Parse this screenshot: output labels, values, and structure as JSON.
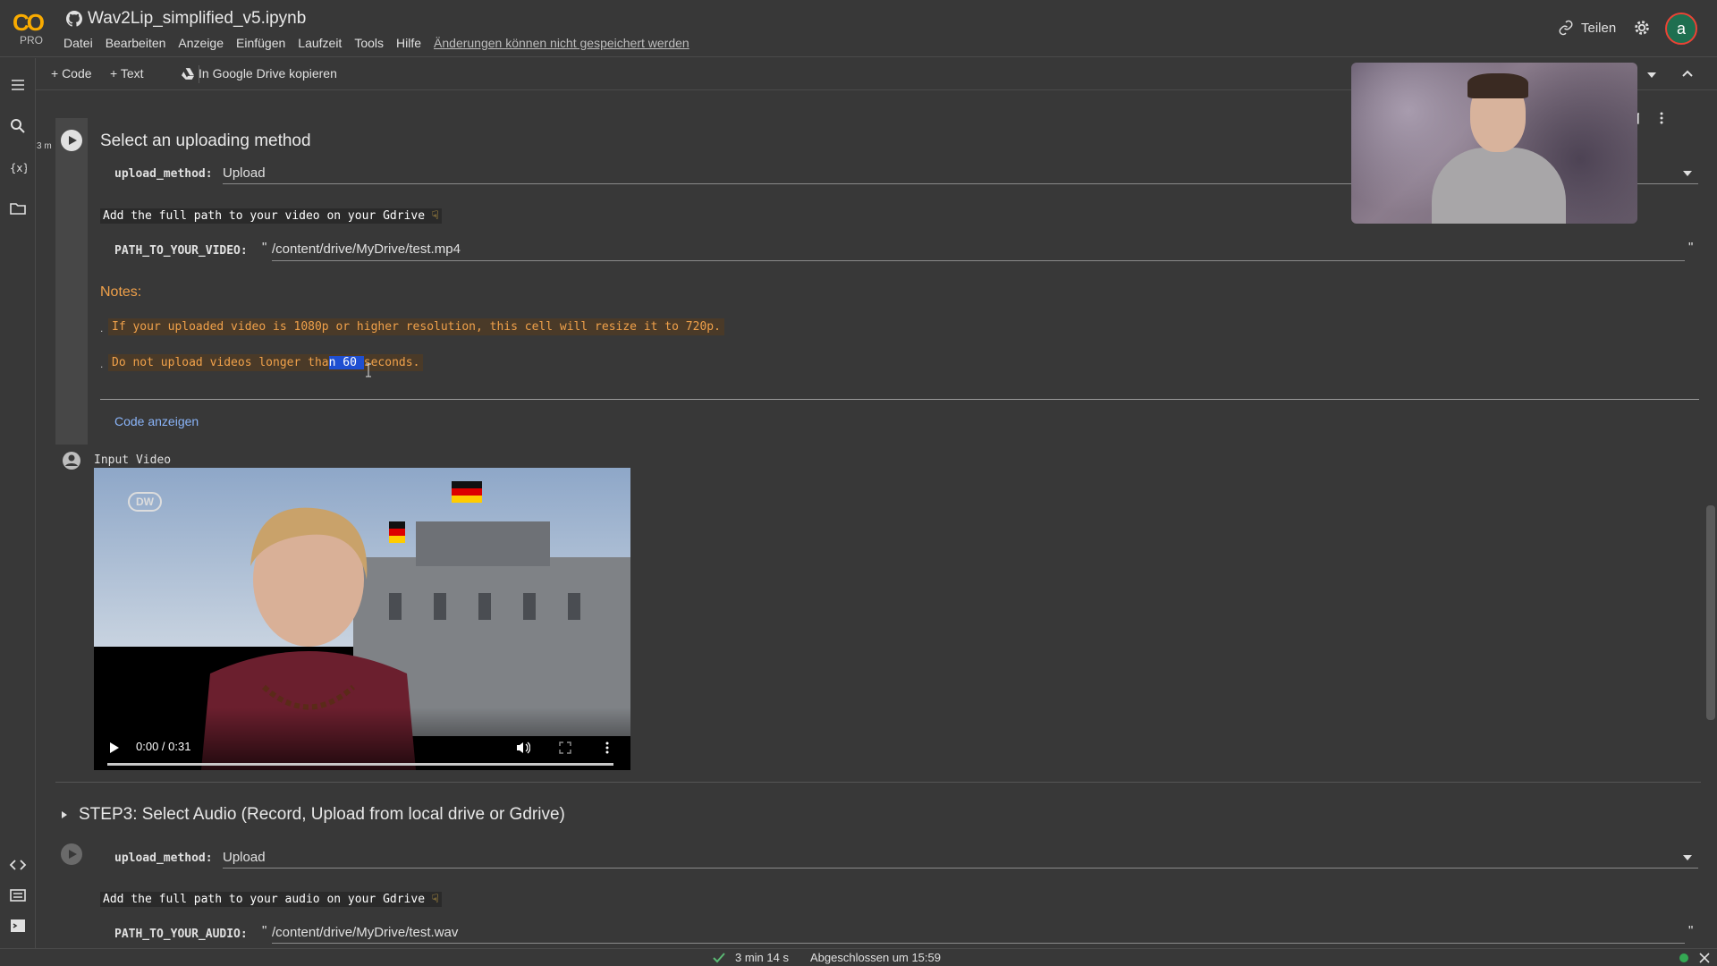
{
  "header": {
    "logo_text": "CO",
    "logo_sub": "PRO",
    "notebook_title": "Wav2Lip_simplified_v5.ipynb",
    "menu": [
      "Datei",
      "Bearbeiten",
      "Anzeige",
      "Einfügen",
      "Laufzeit",
      "Tools",
      "Hilfe"
    ],
    "save_warning": "Änderungen können nicht gespeichert werden",
    "share_label": "Teilen",
    "avatar_letter": "a"
  },
  "toolbar": {
    "add_code": "+ Code",
    "add_text": "+ Text",
    "copy_drive": "In Google Drive kopieren"
  },
  "cell1": {
    "exec_time": "3 m",
    "title": "Select an uploading method",
    "upload_method_label": "upload_method:",
    "upload_method_value": "Upload",
    "path_hint": "Add the full path to your video on your Gdrive",
    "path_label": "PATH_TO_YOUR_VIDEO:",
    "path_quote": "\"",
    "path_value": "/content/drive/MyDrive/test.mp4",
    "path_end_quote": "\"",
    "notes_heading": "Notes:",
    "note1": "If your uploaded video is 1080p or higher resolution, this cell will resize it to 720p.",
    "note2_before": "Do not upload videos longer tha",
    "note2_highlight": "n 60 ",
    "note2_after": "seconds.",
    "show_code": "Code anzeigen"
  },
  "output": {
    "label": "Input Video",
    "video_time": "0:00 / 0:31",
    "watermark": "DW"
  },
  "step3": {
    "title": "STEP3: Select Audio (Record, Upload from local drive or Gdrive)",
    "upload_method_label": "upload_method:",
    "upload_method_value": "Upload",
    "path_hint": "Add the full path to your audio on your Gdrive",
    "path_label": "PATH_TO_YOUR_AUDIO:",
    "path_quote": "\"",
    "path_value": "/content/drive/MyDrive/test.wav",
    "path_end_quote": "\""
  },
  "status": {
    "duration": "3 min 14 s",
    "completed": "Abgeschlossen um 15:59"
  },
  "colors": {
    "background": "#383838",
    "accent": "#f9ab00",
    "link": "#8ab4f8",
    "note": "#f0a14a",
    "highlight": "#1f4fd1"
  }
}
